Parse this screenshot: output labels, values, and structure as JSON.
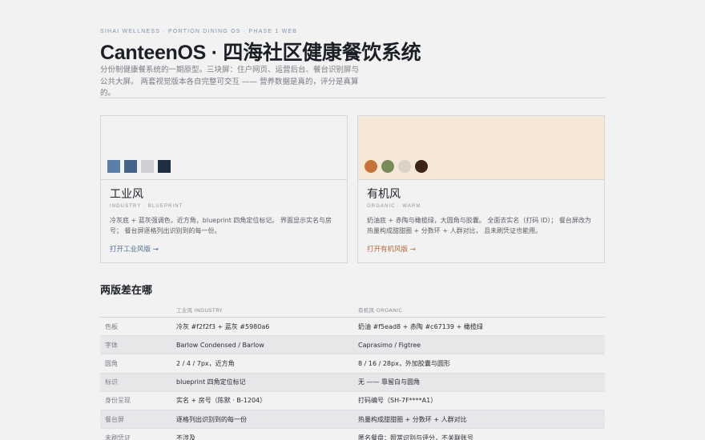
{
  "header": {
    "eyebrow": "SIHAI WELLNESS · PORTION DINING OS · PHASE 1 WEB",
    "title": "CanteenOS · 四海社区健康餐饮系统",
    "intro": "分份制健康餐系统的一期原型。三块屏：住户网页、运营后台、餐台识别屏与公共大屏。 两套视觉版本各自完整可交互 —— 营养数据是真的，评分是真算的。"
  },
  "cards": [
    {
      "key": "industry",
      "name": "工业风",
      "sub": "INDUSTRY · BLUEPRINT",
      "desc": "冷灰底 + 蓝灰强调色，近方角，blueprint 四角定位标记。 界面显示实名与房号； 餐台屏逐格列出识别到的每一份。",
      "link": "打开工业风版 →",
      "swatches": [
        "#5a80a8",
        "#44648a",
        "#d0d0d4",
        "#1f2e40"
      ]
    },
    {
      "key": "organic",
      "name": "有机风",
      "sub": "ORGANIC · WARM",
      "desc": "奶油底 + 赤陶与橄榄绿，大圆角与胶囊。 全面去实名（打码 ID）； 餐台屏改为热量构成甜甜圈 + 分数环 + 人群对比， 且未刷凭证也能用。",
      "link": "打开有机风版 →",
      "swatches": [
        "#c67139",
        "#7a8a58",
        "#dcd3c6",
        "#3e2414"
      ]
    }
  ],
  "compare": {
    "title": "两版差在哪",
    "columns": [
      "",
      "工业风 INDUSTRY",
      "有机风 ORGANIC"
    ],
    "rows": [
      [
        "色板",
        "冷灰 #f2f2f3 + 蓝灰 #5980a6",
        "奶油 #f5ead8 + 赤陶 #c67139 + 橄榄绿"
      ],
      [
        "字体",
        "Barlow Condensed / Barlow",
        "Caprasimo / Figtree"
      ],
      [
        "圆角",
        "2 / 4 / 7px，近方角",
        "8 / 16 / 28px，外加胶囊与圆形"
      ],
      [
        "标识",
        "blueprint 四角定位标记",
        "无 —— 靠留白与圆角"
      ],
      [
        "身份呈现",
        "实名 + 房号（陈默 · B-1204）",
        "打码编号（SH-7F****A1）"
      ],
      [
        "餐台屏",
        "逐格列出识别到的每一份",
        "热量构成甜甜圈 + 分数环 + 人群对比"
      ],
      [
        "未刷凭证",
        "不涉及",
        "匿名餐盘：照常识别与评分，不关联账号"
      ]
    ]
  },
  "colors": {
    "background": "#f2f2f3",
    "industry_accent": "#4c6d95",
    "organic_accent": "#b9663a",
    "organic_card_bg": "#f5e8d6"
  }
}
